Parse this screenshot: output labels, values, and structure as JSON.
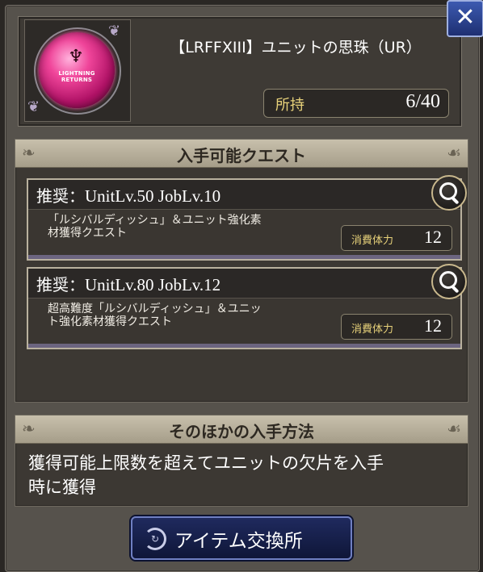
{
  "item": {
    "title": "【LRFFXIII】ユニットの思珠（UR）",
    "orb_text": "LIGHTNING RETURNS",
    "owned_label": "所持",
    "owned_value": "6/40"
  },
  "quests_panel": {
    "title": "入手可能クエスト",
    "quests": [
      {
        "recommend_prefix": "推奨：",
        "recommend": "UnitLv.50 JobLv.10",
        "desc_line1": "「ルシバルディッシュ」＆ユニット強化素",
        "desc_line2": "材獲得クエスト",
        "stamina_label": "消費体力",
        "stamina_value": "12"
      },
      {
        "recommend_prefix": "推奨：",
        "recommend": "UnitLv.80 JobLv.12",
        "desc_line1": "超高難度「ルシバルディッシュ」＆ユニッ",
        "desc_line2": "ト強化素材獲得クエスト",
        "stamina_label": "消費体力",
        "stamina_value": "12"
      }
    ]
  },
  "other_panel": {
    "title": "そのほかの入手方法",
    "line1": "獲得可能上限数を超えてユニットの欠片を入手",
    "line2": "時に獲得"
  },
  "exchange_button": {
    "label": "アイテム交換所"
  },
  "close_button": {
    "label": "✕"
  },
  "icons": [
    "close-icon",
    "magnifier-icon",
    "exchange-icon",
    "orb-icon"
  ],
  "colors": {
    "gold_label": "#e8d27a",
    "button_blue": "#1f2a5e",
    "orb_pink": "#f0459a"
  }
}
